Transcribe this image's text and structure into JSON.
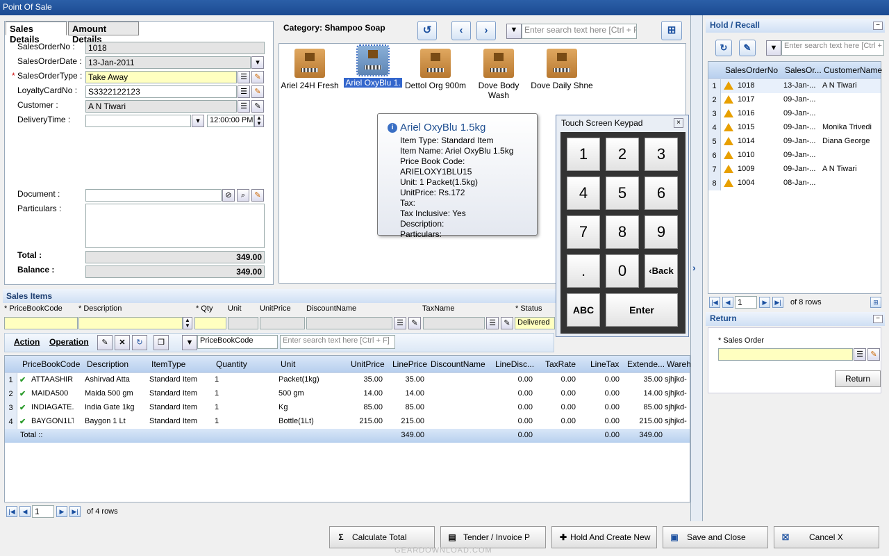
{
  "window": {
    "title": "Point Of Sale"
  },
  "tabs": [
    "Sales Details",
    "Amount Details"
  ],
  "sales": {
    "order_no_label": "SalesOrderNo :",
    "order_no": "1018",
    "order_date_label": "SalesOrderDate :",
    "order_date": "13-Jan-2011",
    "order_type_label": "SalesOrderType :",
    "order_type": "Take Away",
    "loyalty_label": "LoyaltyCardNo :",
    "loyalty": "S3322122123",
    "customer_label": "Customer :",
    "customer": "A N Tiwari",
    "delivery_label": "DeliveryTime :",
    "delivery_time": "12:00:00 PM",
    "document_label": "Document :",
    "particulars_label": "Particulars :",
    "total_label": "Total :",
    "total": "349.00",
    "balance_label": "Balance :",
    "balance": "349.00"
  },
  "catalog": {
    "category": "Category: Shampoo Soap",
    "search_placeholder": "Enter search text here [Ctrl + F]",
    "items": [
      "Ariel 24H Fresh",
      "Ariel OxyBlu 1.",
      "Dettol Org 900m",
      "Dove Body Wash",
      "Dove Daily Shne"
    ]
  },
  "tooltip": {
    "title": "Ariel OxyBlu 1.5kg",
    "lines": [
      "Item Type: Standard Item",
      "Item Name: Ariel OxyBlu 1.5kg",
      "Price Book Code: ARIELOXY1BLU15",
      "Unit: 1 Packet(1.5kg)",
      "UnitPrice: Rs.172",
      "Tax:",
      "Tax Inclusive: Yes",
      "Description:",
      "Particulars:"
    ]
  },
  "keypad": {
    "title": "Touch Screen Keypad",
    "keys": [
      "1",
      "2",
      "3",
      "4",
      "5",
      "6",
      "7",
      "8",
      "9",
      ".",
      "0",
      "‹Back"
    ],
    "abc": "ABC",
    "enter": "Enter"
  },
  "sales_items": {
    "title": "Sales Items",
    "entry_headers": [
      "PriceBookCode",
      "Description",
      "Qty",
      "Unit",
      "UnitPrice",
      "DiscountName",
      "TaxName",
      "Status"
    ],
    "entry_status": "Delivered",
    "action": "Action",
    "operation": "Operation",
    "filter_field": "PriceBookCode",
    "search_placeholder": "Enter search text here [Ctrl + F]",
    "headers": [
      "PriceBookCode",
      "Description",
      "ItemType",
      "Quantity",
      "Unit",
      "UnitPrice",
      "LinePrice",
      "DiscountName",
      "LineDisc...",
      "TaxRate",
      "LineTax",
      "Extende...",
      "Wareh"
    ],
    "rows": [
      [
        "1",
        "ATTAASHIR...",
        "Ashirvad Atta",
        "Standard Item",
        "1",
        "Packet(1kg)",
        "35.00",
        "35.00",
        "",
        "0.00",
        "0.00",
        "0.00",
        "35.00",
        "sjhjkd-"
      ],
      [
        "2",
        "MAIDA500",
        "Maida 500 gm",
        "Standard Item",
        "1",
        "500 gm",
        "14.00",
        "14.00",
        "",
        "0.00",
        "0.00",
        "0.00",
        "14.00",
        "sjhjkd-"
      ],
      [
        "3",
        "INDIAGATE...",
        "India Gate 1kg",
        "Standard Item",
        "1",
        "Kg",
        "85.00",
        "85.00",
        "",
        "0.00",
        "0.00",
        "0.00",
        "85.00",
        "sjhjkd-"
      ],
      [
        "4",
        "BAYGON1LT",
        "Baygon 1 Lt",
        "Standard Item",
        "1",
        "Bottle(1Lt)",
        "215.00",
        "215.00",
        "",
        "0.00",
        "0.00",
        "0.00",
        "215.00",
        "sjhjkd-"
      ]
    ],
    "total_label": "Total ::",
    "total_lineprice": "349.00",
    "total_disc": "0.00",
    "total_tax": "0.00",
    "total_ext": "349.00",
    "page": "1",
    "of_rows": "of 4 rows"
  },
  "hold": {
    "title": "Hold / Recall",
    "search_placeholder": "Enter search text here [Ctrl + F]",
    "headers": [
      "SalesOrderNo",
      "SalesOr...",
      "CustomerName"
    ],
    "rows": [
      [
        "1",
        "1018",
        "13-Jan-...",
        "A N Tiwari"
      ],
      [
        "2",
        "1017",
        "09-Jan-...",
        ""
      ],
      [
        "3",
        "1016",
        "09-Jan-...",
        ""
      ],
      [
        "4",
        "1015",
        "09-Jan-...",
        "Monika Trivedi"
      ],
      [
        "5",
        "1014",
        "09-Jan-...",
        "Diana George"
      ],
      [
        "6",
        "1010",
        "09-Jan-...",
        ""
      ],
      [
        "7",
        "1009",
        "09-Jan-...",
        "A N Tiwari"
      ],
      [
        "8",
        "1004",
        "08-Jan-...",
        ""
      ]
    ],
    "page": "1",
    "of_rows": "of 8 rows"
  },
  "ret": {
    "title": "Return",
    "sales_order_label": "Sales Order",
    "return_btn": "Return"
  },
  "footer": {
    "calc": "Calculate Total",
    "tender": "Tender / Invoice P",
    "hold": "Hold And Create New",
    "save": "Save and Close",
    "cancel": "Cancel X"
  },
  "watermark": "GEARDOWNLOAD.COM"
}
